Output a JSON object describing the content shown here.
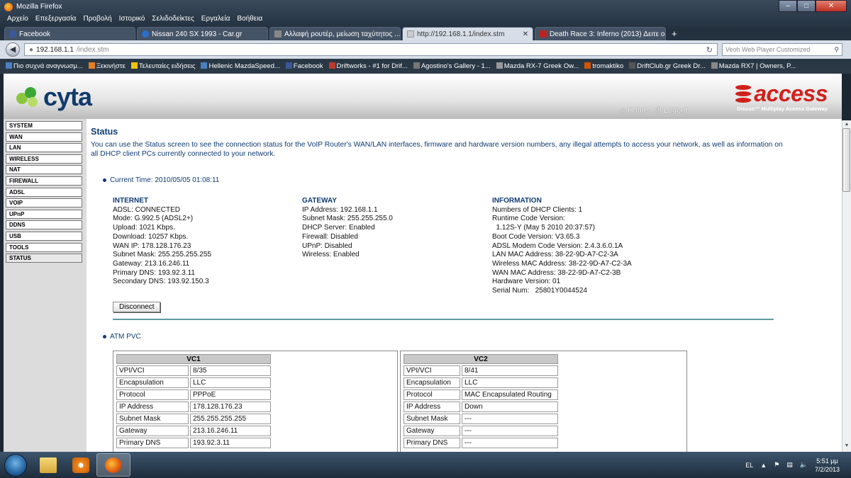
{
  "browser": {
    "window_title": "Mozilla Firefox",
    "menu": [
      "Αρχείο",
      "Επεξεργασία",
      "Προβολή",
      "Ιστορικό",
      "Σελιδοδείκτες",
      "Εργαλεία",
      "Βοήθεια"
    ],
    "tabs": [
      {
        "label": "Facebook",
        "active": false
      },
      {
        "label": "Nissan 240 SX 1993 - Car.gr",
        "active": false
      },
      {
        "label": "Αλλαφή ρουτέρ, μείωση ταχύτητος ...",
        "active": false
      },
      {
        "label": "http://192.168.1.1/index.stm",
        "active": true
      },
      {
        "label": "Death Race 3: Inferno (2013) Δειτε onl...",
        "active": false
      }
    ],
    "new_tab_label": "+",
    "url_host": "192.168.1.1",
    "url_path": "/index.stm",
    "search_placeholder": "Veoh Web Player Customized",
    "bookmarks": [
      "Πιο συχνά αναγνωσμ...",
      "Ξεκινήστε",
      "Τελευταίες ειδήσεις",
      "Hellenic MazdaSpeed...",
      "Facebook",
      "Driftworks - #1 for Drif...",
      "Agostino's Gallery - 1...",
      "Mazda RX-7 Greek Ow...",
      "tromaktiko",
      "DriftClub.gr Greek Dr...",
      "Mazda RX7 | Owners, P..."
    ]
  },
  "router": {
    "brand_left": "cyta",
    "brand_right": "access",
    "brand_right_sub": "Discus™ Multiplay Access Gateway",
    "header_links": {
      "home": "Home",
      "logout": "Logout"
    },
    "sidebar": [
      "SYSTEM",
      "WAN",
      "LAN",
      "WIRELESS",
      "NAT",
      "FIREWALL",
      "ADSL",
      "VOIP",
      "UPnP",
      "DDNS",
      "USB",
      "TOOLS",
      "STATUS"
    ],
    "page_title": "Status",
    "intro": "You can use the Status screen to see the connection status for the VoIP Router's WAN/LAN interfaces, firmware and hardware version numbers, any illegal attempts to access your network, as well as information on all DHCP client PCs currently connected to your network.",
    "current_time": "Current Time: 2010/05/05 01:08:11",
    "internet": {
      "heading": "INTERNET",
      "lines": [
        "ADSL:  CONNECTED",
        "Mode:  G.992.5 (ADSL2+)",
        "Upload:  1021 Kbps.",
        "Download:  10257 Kbps.",
        "WAN IP:  178.128.176.23",
        "Subnet Mask:  255.255.255.255",
        "Gateway:  213.16.246.11",
        "Primary DNS:  193.92.3.11",
        "Secondary DNS:  193.92.150.3"
      ]
    },
    "gateway": {
      "heading": "GATEWAY",
      "lines": [
        "IP Address:  192.168.1.1",
        "Subnet Mask:  255.255.255.0",
        "DHCP Server:  Enabled",
        "Firewall:  Disabled",
        "UPnP:  Disabled",
        "Wireless:  Enabled"
      ]
    },
    "information": {
      "heading": "INFORMATION",
      "lines": [
        "Numbers of DHCP Clients:  1",
        "Runtime Code Version:",
        "  1.12S-Y (May 5 2010 20:37:57)",
        "Boot Code Version:  V3.65.3",
        "ADSL Modem Code Version:  2.4.3.6.0.1A",
        "LAN MAC Address:  38-22-9D-A7-C2-3A",
        "Wireless MAC Address:  38-22-9D-A7-C2-3A",
        "WAN MAC Address:  38-22-9D-A7-C2-3B",
        "Hardware Version:  01",
        "Serial Num:   25801Y0044524"
      ]
    },
    "disconnect_label": "Disconnect",
    "atm_title": "ATM PVC",
    "vc1": {
      "title": "VC1",
      "rows": [
        [
          "VPI/VCI",
          "8/35"
        ],
        [
          "Encapsulation",
          "LLC"
        ],
        [
          "Protocol",
          "PPPoE"
        ],
        [
          "IP Address",
          "178.128.176.23"
        ],
        [
          "Subnet Mask",
          "255.255.255.255"
        ],
        [
          "Gateway",
          "213.16.246.11"
        ],
        [
          "Primary DNS",
          "193.92.3.11"
        ]
      ]
    },
    "vc2": {
      "title": "VC2",
      "rows": [
        [
          "VPI/VCI",
          "8/41"
        ],
        [
          "Encapsulation",
          "LLC"
        ],
        [
          "Protocol",
          "MAC Encapsulated Routing"
        ],
        [
          "IP Address",
          "Down"
        ],
        [
          "Subnet Mask",
          "---"
        ],
        [
          "Gateway",
          "---"
        ],
        [
          "Primary DNS",
          "---"
        ]
      ]
    }
  },
  "taskbar": {
    "language": "EL",
    "time": "5:51 μμ",
    "date": "7/2/2013"
  }
}
